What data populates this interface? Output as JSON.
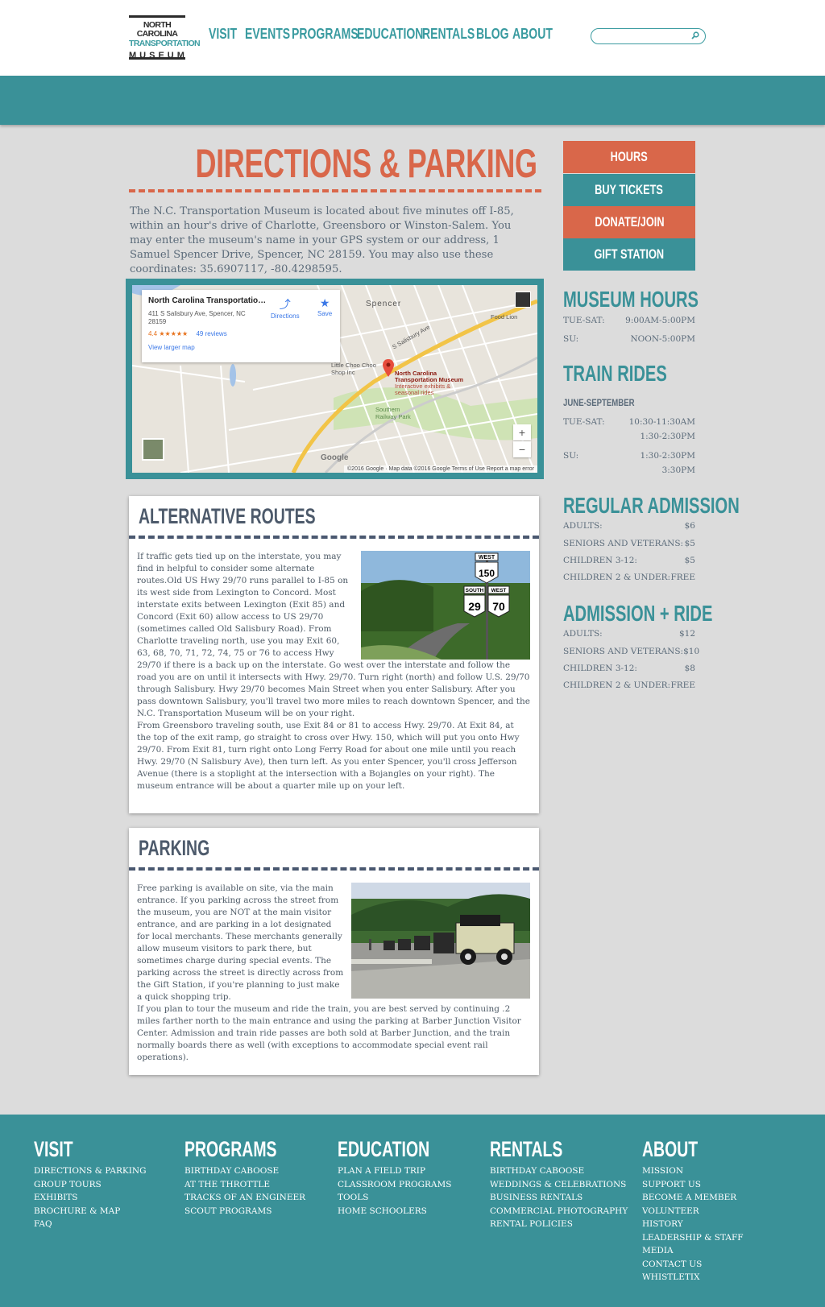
{
  "header": {
    "logo": {
      "line1": "NORTH CAROLINA",
      "line2": "TRANSPORTATION",
      "line3": "MUSEUM"
    },
    "nav": [
      "VISIT",
      "EVENTS",
      "PROGRAMS",
      "EDUCATION",
      "RENTALS",
      "BLOG",
      "ABOUT"
    ],
    "search": {
      "placeholder": "",
      "icon": "search-icon"
    }
  },
  "colors": {
    "teal": "#3a9198",
    "orange": "#d9674a",
    "slate": "#4d5a6b"
  },
  "page": {
    "title": "DIRECTIONS & PARKING",
    "intro": "The N.C. Transportation Museum is located about five minutes off I-85, within an hour's drive of Charlotte, Greensboro or Winston-Salem. You may enter the museum's name in your GPS system or our address, 1 Samuel Spencer Drive, Spencer, NC 28159. You may also use these coordinates: 35.6907117, -80.4298595."
  },
  "map": {
    "place_name": "North Carolina Transportation...",
    "address": "411 S Salisbury Ave, Spencer, NC 28159",
    "rating": "4.4",
    "stars": "★★★★★",
    "reviews": "49 reviews",
    "larger_link": "View larger map",
    "directions": "Directions",
    "save": "Save",
    "pin_label": "North Carolina Transportation Museum",
    "pin_sub": "Interactive exhibits & seasonal rides",
    "labels": [
      "Spencer",
      "S Salisbury Ave",
      "Little Choo Choo Shop Inc",
      "Southern Railway Park",
      "Food Lion",
      "Google"
    ],
    "footer": "©2016 Google · Map data ©2016 Google    Terms of Use    Report a map error"
  },
  "alt_routes": {
    "title": "ALTERNATIVE ROUTES",
    "text": "If traffic gets tied up on the interstate, you may find in helpful to consider some alternate routes.Old US Hwy 29/70 runs parallel to I-85 on its west side from Lexington to Concord. Most interstate exits between Lexington (Exit 85) and Concord (Exit 60) allow access to US 29/70 (sometimes called Old Salisbury Road). From Charlotte traveling north, use you may Exit 60, 63, 68, 70, 71, 72, 74, 75 or 76 to access Hwy 29/70 if there is a back up on the interstate. Go west over the interstate and follow the road you are on until it intersects with Hwy. 29/70. Turn right (north) and follow U.S. 29/70 through Salisbury. Hwy 29/70 becomes Main Street when you enter Salisbury. After you pass downtown Salisbury, you'll travel two more miles to reach downtown Spencer, and the N.C. Transportation Museum will be on your right.",
    "text2": "From Greensboro traveling south, use Exit 84 or 81 to access Hwy. 29/70. At Exit 84, at the top of the exit ramp, go straight to cross over Hwy. 150, which will put you onto Hwy 29/70. From Exit 81, turn right onto Long Ferry Road for about one mile until you reach Hwy. 29/70 (N Salisbury Ave), then turn left. As you enter Spencer, you'll cross Jefferson Avenue (there is a stoplight at the intersection with a Bojangles on your right). The museum entrance will be about a quarter mile up on your left.",
    "signs": [
      "WEST",
      "150",
      "SOUTH",
      "WEST",
      "29",
      "70"
    ]
  },
  "parking": {
    "title": "PARKING",
    "text": "Free parking is available on site, via the main entrance. If you parking across the street from the museum, you are NOT at the main visitor entrance, and are parking in a lot designated for local merchants. These merchants generally allow museum visitors to park there, but sometimes charge during special events. The parking across the street is directly across from the Gift Station, if you're planning to just make a quick shopping trip.",
    "text2": "If you plan to tour the museum and ride the train, you are best served by continuing .2 miles farther north to the main entrance and using the parking at Barber Junction Visitor Center. Admission and train ride passes are both sold at Barber Junction, and the train normally boards there as well (with exceptions to accommodate special event rail operations)."
  },
  "sidebar": {
    "buttons": [
      "HOURS",
      "BUY TICKETS",
      "DONATE/JOIN",
      "GIFT STATION"
    ],
    "museum_hours": {
      "title": "MUSEUM HOURS",
      "rows": [
        {
          "label": "TUE-SAT:",
          "value": "9:00AM-5:00PM"
        },
        {
          "label": "SU:",
          "value": "NOON-5:00PM"
        }
      ]
    },
    "train_rides": {
      "title": "TRAIN RIDES",
      "season": "JUNE-SEPTEMBER",
      "tue_label": "TUE-SAT:",
      "tue_1": "10:30-11:30AM",
      "tue_2": "1:30-2:30PM",
      "su_label": "SU:",
      "su_1": "1:30-2:30PM",
      "su_2": "3:30PM"
    },
    "regular": {
      "title": "REGULAR ADMISSION",
      "rows": [
        {
          "label": "ADULTS:",
          "value": "$6"
        },
        {
          "label": "SENIORS AND VETERANS:",
          "value": "$5"
        },
        {
          "label": "CHILDREN 3-12:",
          "value": "$5"
        },
        {
          "label": "CHILDREN 2 & UNDER:",
          "value": "FREE"
        }
      ]
    },
    "ride": {
      "title": "ADMISSION + RIDE",
      "rows": [
        {
          "label": "ADULTS:",
          "value": "$12"
        },
        {
          "label": "SENIORS AND VETERANS:",
          "value": "$10"
        },
        {
          "label": "CHILDREN 3-12:",
          "value": "$8"
        },
        {
          "label": "CHILDREN 2 & UNDER:",
          "value": "FREE"
        }
      ]
    }
  },
  "footer": {
    "columns": [
      {
        "title": "VISIT",
        "links": [
          "DIRECTIONS & PARKING",
          "GROUP TOURS",
          "EXHIBITS",
          "BROCHURE & MAP",
          "FAQ"
        ]
      },
      {
        "title": "PROGRAMS",
        "links": [
          "BIRTHDAY CABOOSE",
          "AT THE THROTTLE",
          "TRACKS OF AN ENGINEER",
          "SCOUT PROGRAMS"
        ]
      },
      {
        "title": "EDUCATION",
        "links": [
          "PLAN A FIELD TRIP",
          "CLASSROOM PROGRAMS",
          "TOOLS",
          "HOME SCHOOLERS"
        ]
      },
      {
        "title": "RENTALS",
        "links": [
          "BIRTHDAY CABOOSE",
          "WEDDINGS & CELEBRATIONS",
          "BUSINESS RENTALS",
          "COMMERCIAL PHOTOGRAPHY",
          "RENTAL POLICIES"
        ]
      },
      {
        "title": "ABOUT",
        "links": [
          "MISSION",
          "SUPPORT US",
          "BECOME A MEMBER",
          "VOLUNTEER",
          "HISTORY",
          "LEADERSHIP & STAFF",
          "MEDIA",
          "CONTACT US",
          "WHISTLETIX"
        ]
      }
    ]
  }
}
